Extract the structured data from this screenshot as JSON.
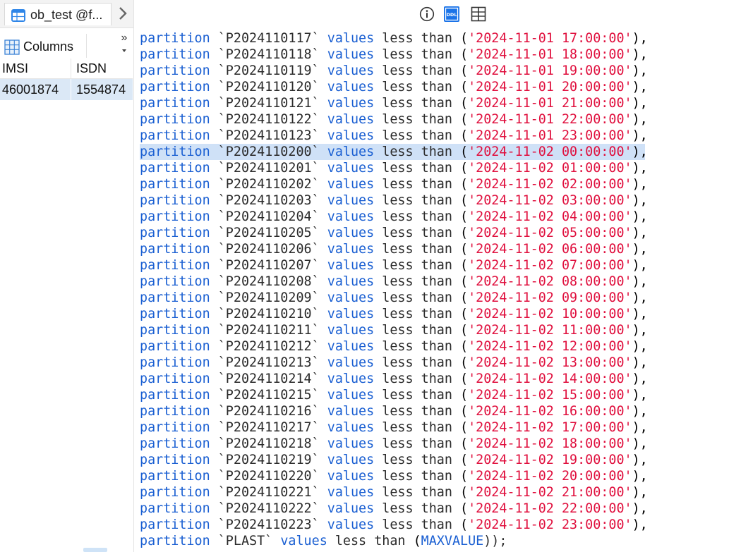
{
  "tab": {
    "title": "ob_test @f..."
  },
  "toolbar": {
    "columns_label": "Columns",
    "more_label": "»"
  },
  "grid": {
    "headers": [
      "IMSI",
      "ISDN"
    ],
    "rows": [
      [
        "46001874",
        "1554874"
      ]
    ]
  },
  "code": {
    "keyword_partition": "partition",
    "keyword_values": "values",
    "text_less_than": "less than",
    "highlighted_index": 7,
    "rows": [
      {
        "name": "`P2024110117`",
        "value": "'2024-11-01 17:00:00'"
      },
      {
        "name": "`P2024110118`",
        "value": "'2024-11-01 18:00:00'"
      },
      {
        "name": "`P2024110119`",
        "value": "'2024-11-01 19:00:00'"
      },
      {
        "name": "`P2024110120`",
        "value": "'2024-11-01 20:00:00'"
      },
      {
        "name": "`P2024110121`",
        "value": "'2024-11-01 21:00:00'"
      },
      {
        "name": "`P2024110122`",
        "value": "'2024-11-01 22:00:00'"
      },
      {
        "name": "`P2024110123`",
        "value": "'2024-11-01 23:00:00'"
      },
      {
        "name": "`P2024110200`",
        "value": "'2024-11-02 00:00:00'"
      },
      {
        "name": "`P2024110201`",
        "value": "'2024-11-02 01:00:00'"
      },
      {
        "name": "`P2024110202`",
        "value": "'2024-11-02 02:00:00'"
      },
      {
        "name": "`P2024110203`",
        "value": "'2024-11-02 03:00:00'"
      },
      {
        "name": "`P2024110204`",
        "value": "'2024-11-02 04:00:00'"
      },
      {
        "name": "`P2024110205`",
        "value": "'2024-11-02 05:00:00'"
      },
      {
        "name": "`P2024110206`",
        "value": "'2024-11-02 06:00:00'"
      },
      {
        "name": "`P2024110207`",
        "value": "'2024-11-02 07:00:00'"
      },
      {
        "name": "`P2024110208`",
        "value": "'2024-11-02 08:00:00'"
      },
      {
        "name": "`P2024110209`",
        "value": "'2024-11-02 09:00:00'"
      },
      {
        "name": "`P2024110210`",
        "value": "'2024-11-02 10:00:00'"
      },
      {
        "name": "`P2024110211`",
        "value": "'2024-11-02 11:00:00'"
      },
      {
        "name": "`P2024110212`",
        "value": "'2024-11-02 12:00:00'"
      },
      {
        "name": "`P2024110213`",
        "value": "'2024-11-02 13:00:00'"
      },
      {
        "name": "`P2024110214`",
        "value": "'2024-11-02 14:00:00'"
      },
      {
        "name": "`P2024110215`",
        "value": "'2024-11-02 15:00:00'"
      },
      {
        "name": "`P2024110216`",
        "value": "'2024-11-02 16:00:00'"
      },
      {
        "name": "`P2024110217`",
        "value": "'2024-11-02 17:00:00'"
      },
      {
        "name": "`P2024110218`",
        "value": "'2024-11-02 18:00:00'"
      },
      {
        "name": "`P2024110219`",
        "value": "'2024-11-02 19:00:00'"
      },
      {
        "name": "`P2024110220`",
        "value": "'2024-11-02 20:00:00'"
      },
      {
        "name": "`P2024110221`",
        "value": "'2024-11-02 21:00:00'"
      },
      {
        "name": "`P2024110222`",
        "value": "'2024-11-02 22:00:00'"
      },
      {
        "name": "`P2024110223`",
        "value": "'2024-11-02 23:00:00'"
      }
    ],
    "last_line": {
      "name": "`PLAST`",
      "value": "MAXVALUE",
      "ending": "));"
    }
  },
  "icons": {
    "tab": "table-icon",
    "chevron": "chevron-right-icon",
    "columns": "columns-grid-icon",
    "info": "info-icon",
    "ddl": "ddl-icon",
    "split": "split-view-icon"
  },
  "colors": {
    "keyword": "#1a5fd2",
    "string": "#e0103e",
    "highlight": "#cfe1f7",
    "selected_row": "#dbe8f6"
  }
}
